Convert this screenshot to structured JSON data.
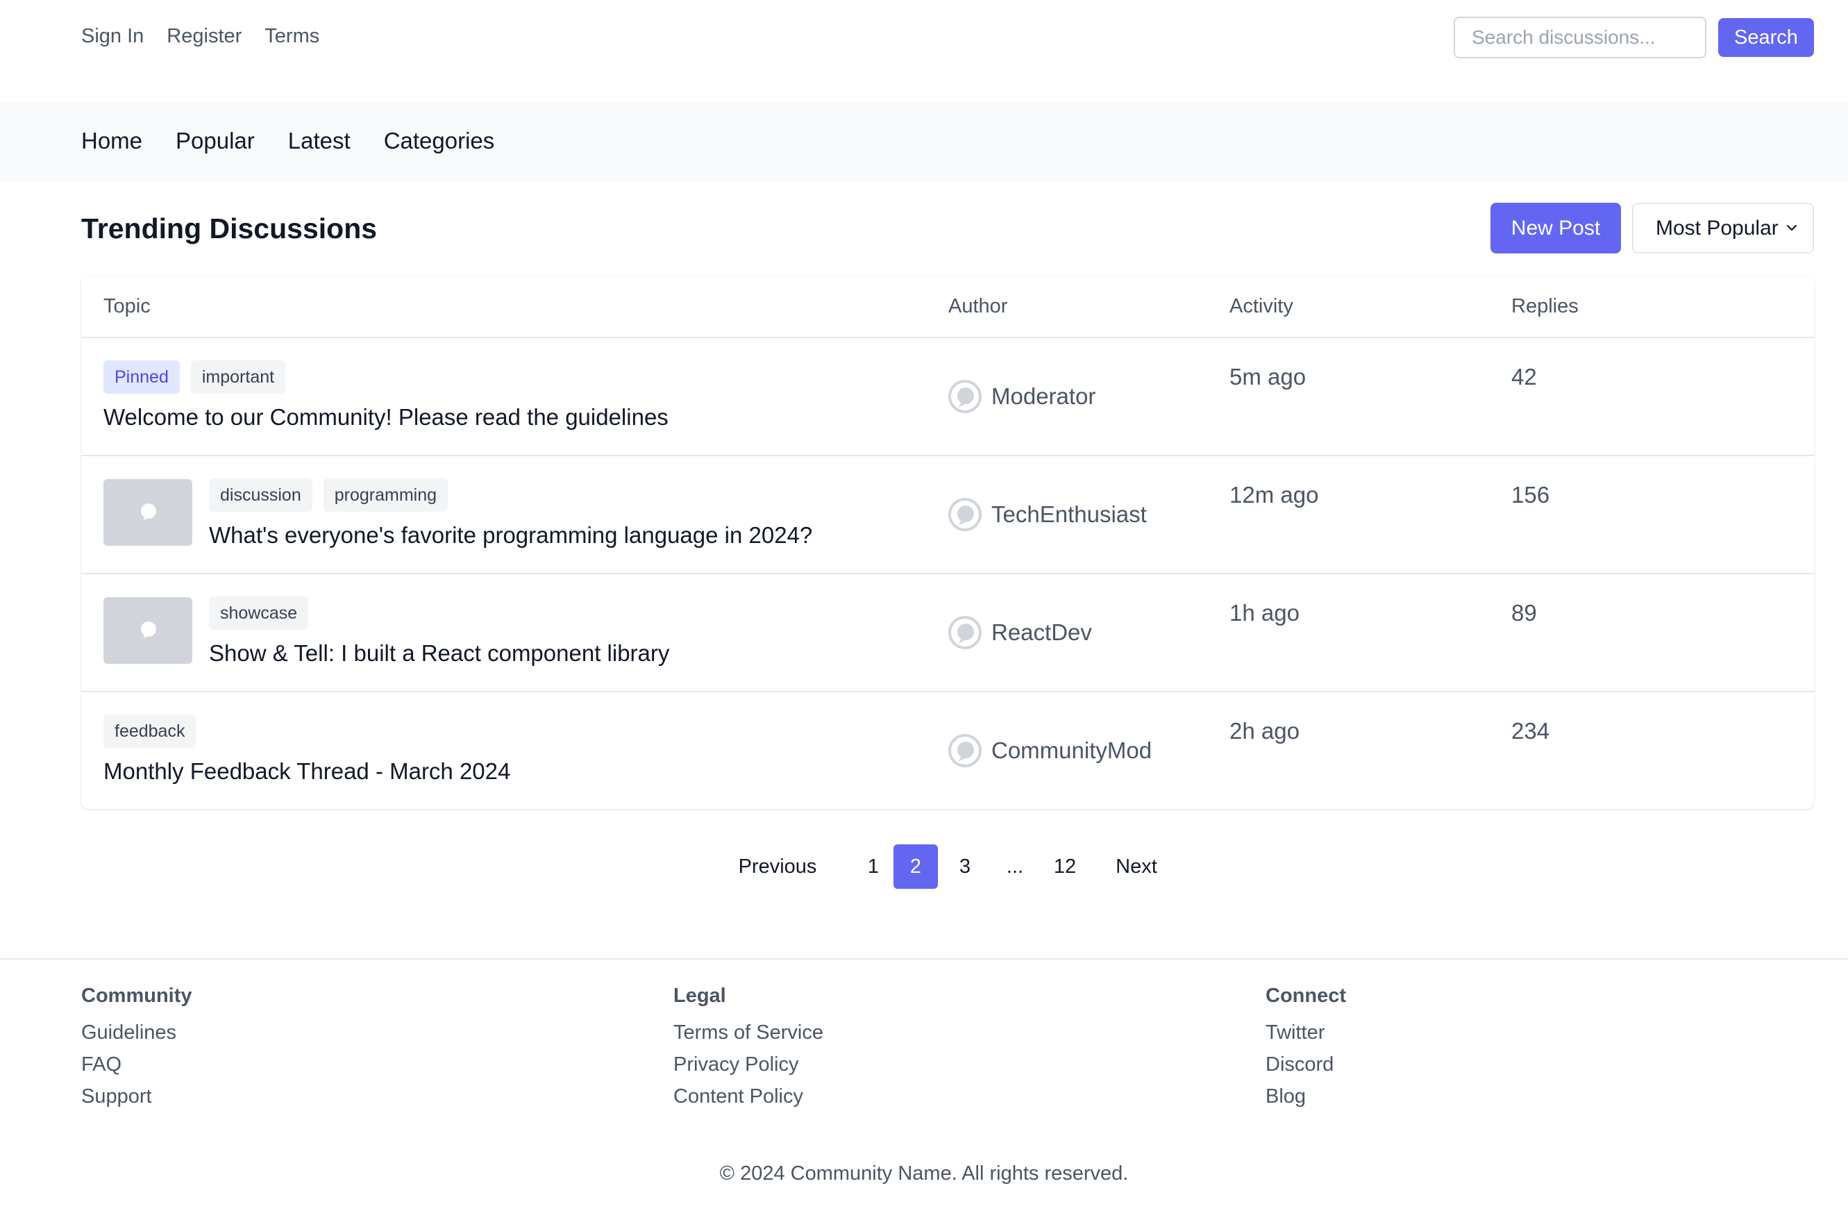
{
  "header": {
    "links": [
      "Sign In",
      "Register",
      "Terms"
    ],
    "search_placeholder": "Search discussions...",
    "search_label": "Search"
  },
  "nav": {
    "items": [
      "Home",
      "Popular",
      "Latest",
      "Categories"
    ]
  },
  "main": {
    "title": "Trending Discussions",
    "new_post_label": "New Post",
    "sort_value": "Most Popular"
  },
  "table": {
    "columns": [
      "Topic",
      "Author",
      "Activity",
      "Replies"
    ],
    "rows": [
      {
        "tags": [
          "Pinned",
          "important"
        ],
        "title": "Welcome to our Community! Please read the guidelines",
        "author": "Moderator",
        "activity": "5m ago",
        "replies": "42"
      },
      {
        "tags": [
          "discussion",
          "programming"
        ],
        "title": "What's everyone's favorite programming language in 2024?",
        "author": "TechEnthusiast",
        "activity": "12m ago",
        "replies": "156"
      },
      {
        "tags": [
          "showcase"
        ],
        "title": "Show & Tell: I built a React component library",
        "author": "ReactDev",
        "activity": "1h ago",
        "replies": "89"
      },
      {
        "tags": [
          "feedback"
        ],
        "title": "Monthly Feedback Thread - March 2024",
        "author": "CommunityMod",
        "activity": "2h ago",
        "replies": "234"
      }
    ]
  },
  "pagination": {
    "previous": "Previous",
    "pages": [
      "1",
      "2",
      "3",
      "...",
      "12"
    ],
    "next": "Next",
    "current": "2"
  },
  "footer": {
    "columns": [
      {
        "heading": "Community",
        "links": [
          "Guidelines",
          "FAQ",
          "Support"
        ]
      },
      {
        "heading": "Legal",
        "links": [
          "Terms of Service",
          "Privacy Policy",
          "Content Policy"
        ]
      },
      {
        "heading": "Connect",
        "links": [
          "Twitter",
          "Discord",
          "Blog"
        ]
      }
    ],
    "copyright": "© 2024 Community Name. All rights reserved."
  },
  "colors": {
    "accent": "#6366f1",
    "pinned_bg": "#e0e7ff",
    "pinned_text": "#4f46e5"
  }
}
